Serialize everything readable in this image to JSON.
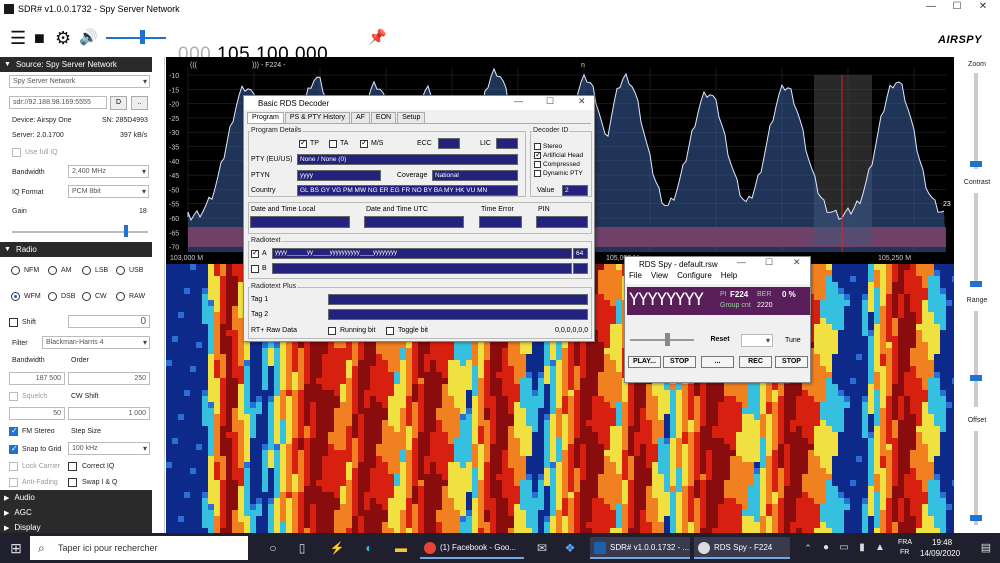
{
  "window": {
    "title": "SDR# v1.0.0.1732 - Spy Server Network",
    "minimize": "—",
    "maximize": "☐",
    "close": "✕"
  },
  "toolbar": {
    "freq_prefix": "000.",
    "freq_main": "105.100.000",
    "brand": "AIRSPY"
  },
  "source": {
    "header": "Source: Spy Server Network",
    "type": "Spy Server Network",
    "uri": "sdr://92.188.98.169:5555",
    "btn_d": "D",
    "btn_more": "..",
    "device_label": "Device: Airspy One",
    "sn_label": "SN: 285D4993",
    "server_label": "Server: 2.0.1700",
    "rate": "397 kB/s",
    "use_full_iq": "Use full IQ",
    "bandwidth_label": "Bandwidth",
    "bandwidth": "2,400 MHz",
    "iq_format_label": "IQ Format",
    "iq_format": "PCM 8bit",
    "gain_label": "Gain",
    "gain_value": "18"
  },
  "radio": {
    "header": "Radio",
    "modes": [
      "NFM",
      "AM",
      "LSB",
      "USB",
      "WFM",
      "DSB",
      "CW",
      "RAW"
    ],
    "selected_mode": "WFM",
    "shift_label": "Shift",
    "shift_value": "0",
    "filter_label": "Filter",
    "filter": "Blackman-Harris 4",
    "bandwidth_label": "Bandwidth",
    "order_label": "Order",
    "bandwidth": "187 500",
    "order": "250",
    "squelch_label": "Squelch",
    "cw_shift_label": "CW Shift",
    "squelch": "50",
    "cw_shift": "1 000",
    "fm_stereo": "FM Stereo",
    "step_size_label": "Step Size",
    "snap_to_grid": "Snap to Grid",
    "step_size": "100 kHz",
    "lock_carrier": "Lock Carrier",
    "correct_iq": "Correct IQ",
    "anti_fading": "Anti-Fading",
    "swap_iq": "Swap I & Q"
  },
  "collapsed_sections": [
    "Audio",
    "AGC",
    "Display"
  ],
  "spectrum": {
    "top_label_1": "(((",
    "top_label_2": "))) - F224 -",
    "top_label_3": "n",
    "db_ticks": [
      "-10",
      "-15",
      "-20",
      "-25",
      "-30",
      "-35",
      "-40",
      "-45",
      "-50",
      "-55",
      "-60",
      "-65",
      "-70"
    ],
    "freq_ticks": [
      "103,000 M",
      "105,000 M",
      "105,250 M"
    ],
    "side_value": "23"
  },
  "right_sliders": {
    "zoom": "Zoom",
    "contrast": "Contrast",
    "range": "Range",
    "offset": "Offset"
  },
  "rds_decoder": {
    "title": "Basic RDS Decoder",
    "tabs": [
      "Program",
      "PS & PTY History",
      "AF",
      "EON",
      "Setup"
    ],
    "program_details": "Program Details",
    "tp": "TP",
    "ta": "TA",
    "ms": "M/S",
    "ecc": "ECC",
    "lic": "LIC",
    "pty_label": "PTY (EU/US)",
    "pty": "None / None (0)",
    "ptyn_label": "PTYN",
    "ptyn": "yyyy",
    "coverage_label": "Coverage",
    "coverage": "National",
    "country_label": "Country",
    "country": "GL BS GY VG PM MW NG ER EG FR NO BY BA MY HK VU MN",
    "decoder_id": "Decoder ID",
    "stereo": "Stereo",
    "artificial_head": "Artificial Head",
    "compressed": "Compressed",
    "dynamic_pty": "Dynamic PTY",
    "value_label": "Value",
    "value": "2",
    "date_local": "Date and Time Local",
    "date_utc": "Date and Time UTC",
    "time_error": "Time Error",
    "pin": "PIN",
    "radiotext": "Radiotext",
    "rt_a_label": "A",
    "rt_a": "yyyy______yy_____yyyyyyyyyy____yyyyyyyy",
    "rt_a_count": "64",
    "rt_b_label": "B",
    "rt_plus": "Radiotext Plus",
    "tag1": "Tag 1",
    "tag2": "Tag 2",
    "rt_raw": "RT+ Raw Data",
    "running_bit": "Running bit",
    "toggle_bit": "Toggle bit",
    "raw_value": "0,0,0,0,0,0"
  },
  "rds_spy": {
    "title": "RDS Spy - default.rsw",
    "menu": [
      "File",
      "View",
      "Configure",
      "Help"
    ],
    "ps": "YYYYYYYY",
    "pi_label": "PI",
    "pi": "F224",
    "ber_label": "BER",
    "ber": "0 %",
    "group_cnt_label": "Group cnt",
    "group_cnt": "2220",
    "reset": "Reset",
    "tune": "Tune",
    "play": "PLAY...",
    "stop1": "STOP",
    "dots": "...",
    "rec": "REC",
    "stop2": "STOP"
  },
  "taskbar": {
    "search_placeholder": "Taper ici pour rechercher",
    "apps": [
      "(1) Facebook - Goo...",
      "SDR# v1.0.0.1732 - ...",
      "RDS Spy - F224"
    ],
    "lang1": "FRA",
    "lang2": "FR",
    "time": "19:48",
    "date": "14/09/2020"
  }
}
